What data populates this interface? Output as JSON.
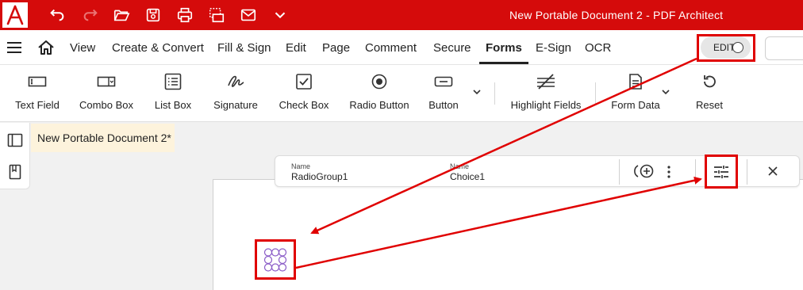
{
  "app": {
    "title": "New Portable Document 2  -  PDF Architect",
    "brand_color": "#d50b0b"
  },
  "quick_access": {
    "icons": [
      "undo-icon",
      "redo-icon",
      "open-folder-icon",
      "save-icon",
      "print-icon",
      "scan-icon",
      "email-icon",
      "chevron-down-icon"
    ]
  },
  "menu": {
    "items": [
      "View",
      "Create & Convert",
      "Fill & Sign",
      "Edit",
      "Page",
      "Comment",
      "Secure",
      "Forms",
      "E-Sign",
      "OCR"
    ],
    "active": "Forms"
  },
  "edit_toggle": {
    "label": "EDIT",
    "state": "off"
  },
  "toolbar": {
    "tools": [
      {
        "label": "Text Field",
        "icon": "text-field-icon"
      },
      {
        "label": "Combo Box",
        "icon": "combo-box-icon"
      },
      {
        "label": "List Box",
        "icon": "list-box-icon"
      },
      {
        "label": "Signature",
        "icon": "signature-icon"
      },
      {
        "label": "Check Box",
        "icon": "check-box-icon"
      },
      {
        "label": "Radio Button",
        "icon": "radio-button-icon"
      },
      {
        "label": "Button",
        "icon": "button-icon"
      },
      {
        "label": "Highlight Fields",
        "icon": "highlight-fields-icon"
      },
      {
        "label": "Form Data",
        "icon": "form-data-icon"
      },
      {
        "label": "Reset",
        "icon": "reset-icon"
      }
    ]
  },
  "document": {
    "tab_title": "New Portable Document 2*"
  },
  "properties_bar": {
    "group_name_caption": "Name",
    "group_name_value": "RadioGroup1",
    "choice_name_caption": "Name",
    "choice_name_value": "Choice1"
  },
  "annotation_color": "#e00000",
  "radio_color": "#8a5cc7"
}
